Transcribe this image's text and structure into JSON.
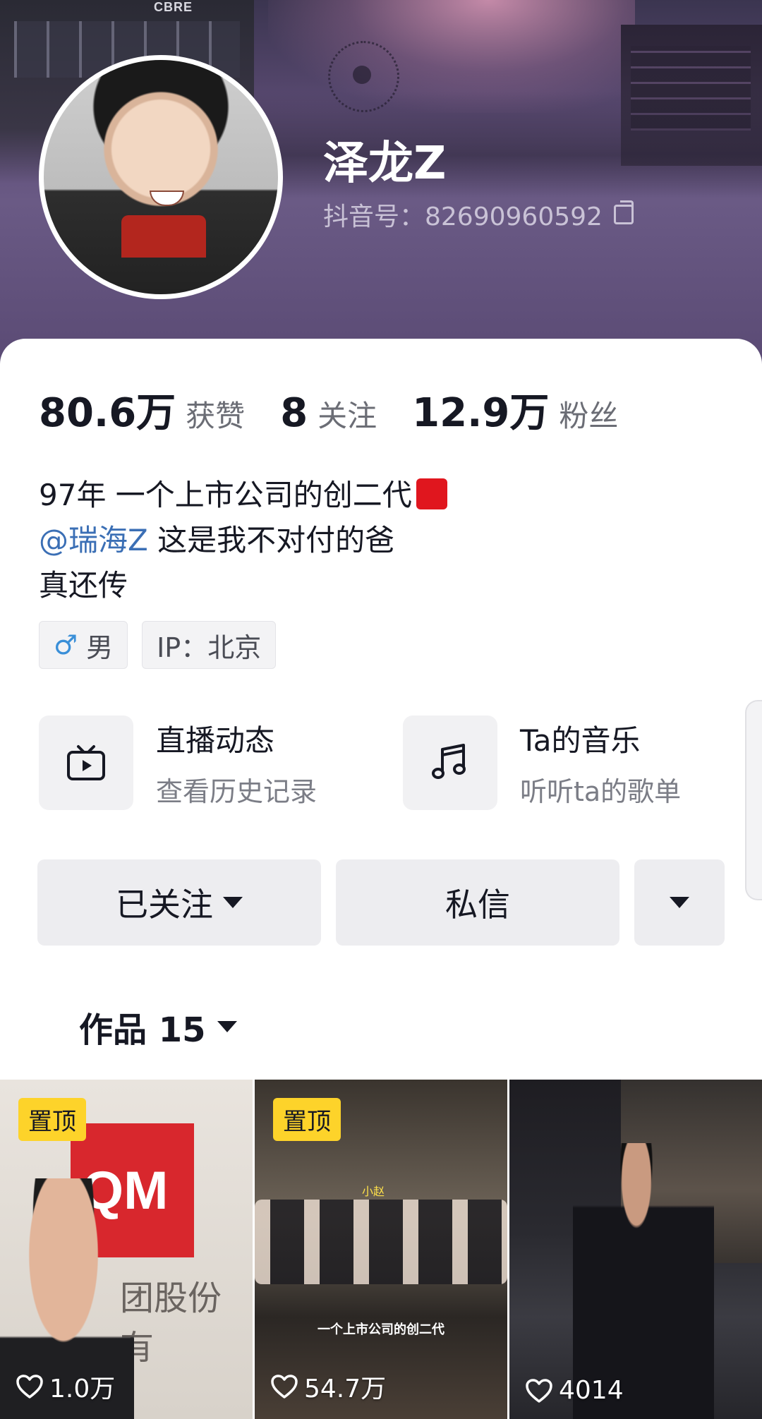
{
  "header": {
    "cover_sign": "CBRE",
    "nickname": "泽龙Z",
    "douyin_id": "抖音号：82690960592"
  },
  "stats": [
    {
      "value": "80.6万",
      "label": "获赞"
    },
    {
      "value": "8",
      "label": "关注"
    },
    {
      "value": "12.9万",
      "label": "粉丝"
    }
  ],
  "bio": {
    "line1": "97年 一个上市公司的创二代",
    "mention": "@瑞海Z",
    "line2_rest": " 这是我不对付的爸",
    "line3": "真还传"
  },
  "tags": {
    "gender_symbol": "♂",
    "gender": "男",
    "ip": "IP：北京"
  },
  "features": [
    {
      "title": "直播动态",
      "subtitle": "查看历史记录",
      "icon": "tv-play-icon"
    },
    {
      "title": "Ta的音乐",
      "subtitle": "听听ta的歌单",
      "icon": "music-note-icon"
    }
  ],
  "actions": {
    "follow": "已关注",
    "message": "私信"
  },
  "works": {
    "label": "作品 15"
  },
  "videos": [
    {
      "pinned": "置顶",
      "likes": "1.0万",
      "overlay": "团股份有",
      "overlay_logo": "QM"
    },
    {
      "pinned": "置顶",
      "likes": "54.7万",
      "overlay": "一个上市公司的创二代",
      "name_tag": "小赵"
    },
    {
      "pinned": "",
      "likes": "4014"
    }
  ],
  "colors": {
    "cover": "#5a4a72",
    "mention": "#3b6fb5",
    "pin_badge": "#fdd32a",
    "button_bg": "#ededf0"
  }
}
